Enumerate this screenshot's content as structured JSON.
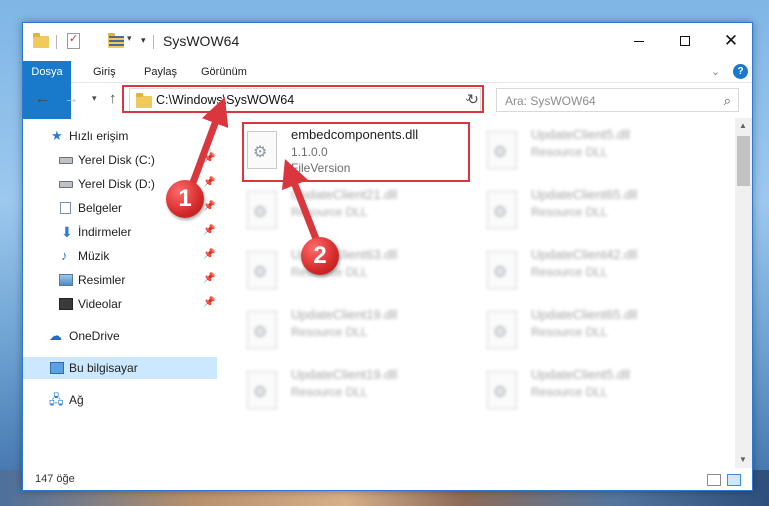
{
  "window": {
    "title": "SysWOW64"
  },
  "ribbon": {
    "tabs": [
      "Dosya",
      "Giriş",
      "Paylaş",
      "Görünüm"
    ],
    "help": "?"
  },
  "nav": {
    "back_icon": "arrow-left-icon",
    "forward_icon": "arrow-right-icon",
    "up_icon": "arrow-up-icon",
    "address": "C:\\Windows\\SysWOW64",
    "search_placeholder": "Ara: SysWOW64"
  },
  "sidebar": {
    "items": [
      {
        "label": "Hızlı erişim",
        "icon": "star-icon",
        "pinned": false
      },
      {
        "label": "Yerel Disk (C:)",
        "icon": "drive-icon",
        "pinned": true
      },
      {
        "label": "Yerel Disk (D:)",
        "icon": "drive-icon",
        "pinned": true
      },
      {
        "label": "Belgeler",
        "icon": "document-icon",
        "pinned": true
      },
      {
        "label": "İndirmeler",
        "icon": "download-icon",
        "pinned": true
      },
      {
        "label": "Müzik",
        "icon": "music-icon",
        "pinned": true
      },
      {
        "label": "Resimler",
        "icon": "pictures-icon",
        "pinned": true
      },
      {
        "label": "Videolar",
        "icon": "video-icon",
        "pinned": true
      },
      {
        "label": "OneDrive",
        "icon": "cloud-icon",
        "pinned": false
      },
      {
        "label": "Bu bilgisayar",
        "icon": "computer-icon",
        "pinned": false,
        "selected": true
      },
      {
        "label": "Ağ",
        "icon": "network-icon",
        "pinned": false
      }
    ]
  },
  "files": [
    {
      "name": "embedcomponents.dll",
      "line2": "1.1.0.0",
      "line3": "FileVersion",
      "highlighted": true
    },
    {
      "name": "UpdateClient5.dll",
      "line2": "Resource DLL"
    },
    {
      "name": "UpdateClient21.dll",
      "line2": "Resource DLL"
    },
    {
      "name": "UpdateClient65.dll",
      "line2": "Resource DLL"
    },
    {
      "name": "UpdateClient63.dll",
      "line2": "Resource DLL"
    },
    {
      "name": "UpdateClient42.dll",
      "line2": "Resource DLL"
    },
    {
      "name": "UpdateClient19.dll",
      "line2": "Resource DLL"
    },
    {
      "name": "UpdateClient65.dll",
      "line2": "Resource DLL"
    },
    {
      "name": "UpdateClient19.dll",
      "line2": "Resource DLL"
    },
    {
      "name": "UpdateClient5.dll",
      "line2": "Resource DLL"
    }
  ],
  "status": {
    "count": "147 öğe"
  },
  "annotations": {
    "badge1": "1",
    "badge2": "2",
    "color": "#d9363e"
  }
}
